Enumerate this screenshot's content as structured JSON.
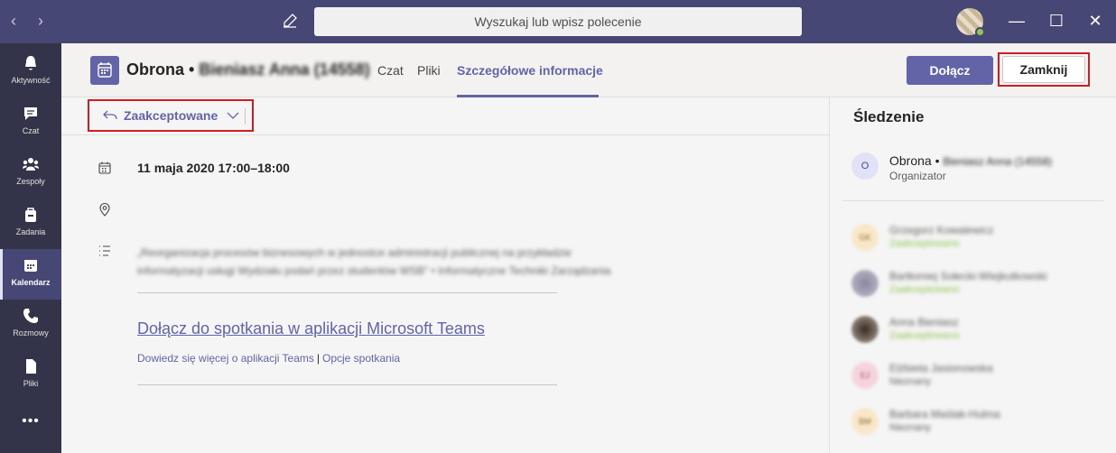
{
  "titlebar": {
    "back_icon": "chevron-left-icon",
    "forward_icon": "chevron-right-icon",
    "compose_icon": "compose-icon",
    "search_placeholder": "Wyszukaj lub wpisz polecenie",
    "window_controls": [
      "—",
      "☐",
      "✕"
    ]
  },
  "rail": {
    "items": [
      {
        "label": "Aktywność",
        "icon": "bell-icon"
      },
      {
        "label": "Czat",
        "icon": "chat-icon"
      },
      {
        "label": "Zespoły",
        "icon": "teams-icon"
      },
      {
        "label": "Zadania",
        "icon": "tasks-icon"
      },
      {
        "label": "Kalendarz",
        "icon": "calendar-icon",
        "active": true
      },
      {
        "label": "Rozmowy",
        "icon": "phone-icon"
      },
      {
        "label": "Pliki",
        "icon": "files-icon"
      },
      {
        "label": "•••",
        "icon": "more-icon"
      }
    ]
  },
  "header": {
    "title": "Obrona •",
    "title_blurred": "Bieniasz Anna (14558)",
    "tabs": [
      "Czat",
      "Pliki",
      "Szczegółowe informacje"
    ],
    "active_tab": "Szczegółowe informacje",
    "join_label": "Dołącz",
    "close_label": "Zamknij"
  },
  "toolbar": {
    "rsvp_label": "Zaakceptowane"
  },
  "details": {
    "date_time": "11 maja 2020 17:00–18:00",
    "description_line1": "„Reorganizacja procesów biznesowych w jednostce administracji publicznej na przykładzie",
    "description_line2": "informatyzacji usługi Wydziału podań przez studentów WSB\" • Informatyczne Techniki Zarządzania",
    "join_link": "Dołącz do spotkania w aplikacji Microsoft Teams",
    "learn_more": "Dowiedz się więcej o aplikacji Teams",
    "meeting_options": "Opcje spotkania",
    "separator": "|"
  },
  "tracking": {
    "title": "Śledzenie",
    "organizer": {
      "initial": "O",
      "name": "Obrona •",
      "name_blurred": "Bieniasz Anna (14558)",
      "role": "Organizator"
    },
    "attendees": [
      {
        "initials": "GK",
        "name": "Grzegorz Kowalewicz",
        "status": "Zaakceptowano",
        "status_color": "#92c353",
        "avatar_color": "#f8e7c8"
      },
      {
        "initials": "",
        "name": "Bartłomiej Sołecki-Wiejkutkowski",
        "status": "Zaakceptowano",
        "status_color": "#92c353",
        "avatar_color": "#a8a4b8"
      },
      {
        "initials": "",
        "name": "Anna Bieniasz",
        "status": "Zaakceptowano",
        "status_color": "#92c353",
        "avatar_color": "#6a5a50"
      },
      {
        "initials": "EJ",
        "name": "Elżbieta Jasionowska",
        "status": "Nieznany",
        "status_color": "#605e5c",
        "avatar_color": "#f6d4dc"
      },
      {
        "initials": "BM",
        "name": "Barbara Maślak-Hulma",
        "status": "Nieznany",
        "status_color": "#605e5c",
        "avatar_color": "#f8e7c8"
      }
    ]
  },
  "colors": {
    "brand": "#6264a7",
    "titlebar": "#464775",
    "rail": "#33344a",
    "highlight_border": "#d11c24"
  }
}
